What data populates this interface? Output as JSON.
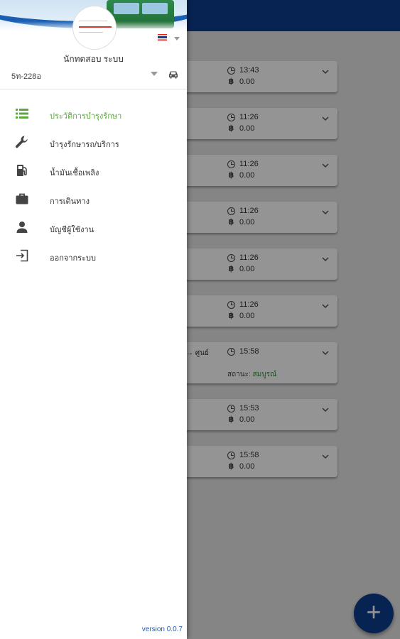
{
  "drawer": {
    "username": "นักทดสอบ ระบบ",
    "vehicle": "5ท-228อ",
    "language_flag": "thai-flag-icon",
    "menu": [
      {
        "label": "ประวัติการบำรุงรักษา",
        "icon": "list-icon",
        "active": true
      },
      {
        "label": "บำรุงรักษารถ/บริการ",
        "icon": "wrench-icon",
        "active": false
      },
      {
        "label": "น้ำมันเชื้อเพลิง",
        "icon": "fuel-icon",
        "active": false
      },
      {
        "label": "การเดินทาง",
        "icon": "briefcase-icon",
        "active": false
      },
      {
        "label": "บัญชีผู้ใช้งาน",
        "icon": "person-icon",
        "active": false
      },
      {
        "label": "ออกจากระบบ",
        "icon": "logout-icon",
        "active": false
      }
    ],
    "version": "version 0.0.7"
  },
  "list": {
    "cards": [
      {
        "time": "13:43",
        "cost": "0.00"
      },
      {
        "time": "11:26",
        "cost": "0.00"
      },
      {
        "time": "11:26",
        "cost": "0.00"
      },
      {
        "time": "11:26",
        "cost": "0.00"
      },
      {
        "time": "11:26",
        "cost": "0.00"
      },
      {
        "time": "11:26",
        "cost": "0.00"
      },
      {
        "time": "15:58",
        "route": "→ ศูนย์",
        "status_label": "สถานะ:",
        "status_value": "สมบูรณ์"
      },
      {
        "time": "15:53",
        "cost": "0.00"
      },
      {
        "time": "15:58",
        "cost": "0.00"
      }
    ]
  },
  "fab": {
    "label": "+"
  },
  "colors": {
    "primary": "#0d3d8c",
    "active": "#5aa83e",
    "status_ok": "#2e8b2e"
  }
}
